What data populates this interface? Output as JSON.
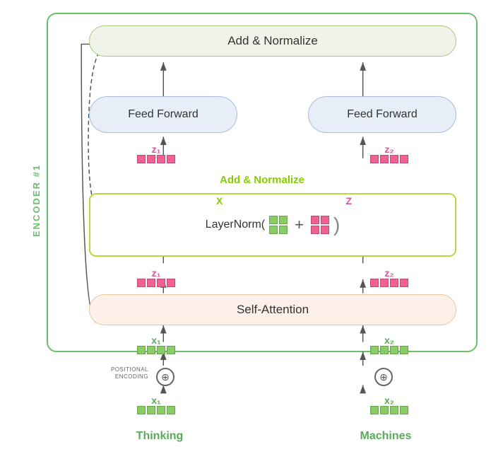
{
  "encoder": {
    "label": "ENCODER #1",
    "add_norm_top": "Add & Normalize",
    "feed_forward_left": "Feed Forward",
    "feed_forward_right": "Feed Forward",
    "add_norm_inner": "Add & Normalize",
    "layer_norm_text": "LayerNorm(",
    "layer_norm_plus": "+",
    "layer_norm_close": ")",
    "self_attention": "Self-Attention",
    "positional_encoding": "POSITIONAL\nENCODING",
    "pos_enc_symbol": "⊕",
    "x_label_1": "X",
    "z_label": "Z",
    "plus_symbol": "+"
  },
  "labels": {
    "z1": "z₁",
    "z2": "z₂",
    "x1": "x₁",
    "x2": "x₂"
  },
  "words": {
    "thinking": "Thinking",
    "machines": "Machines"
  }
}
